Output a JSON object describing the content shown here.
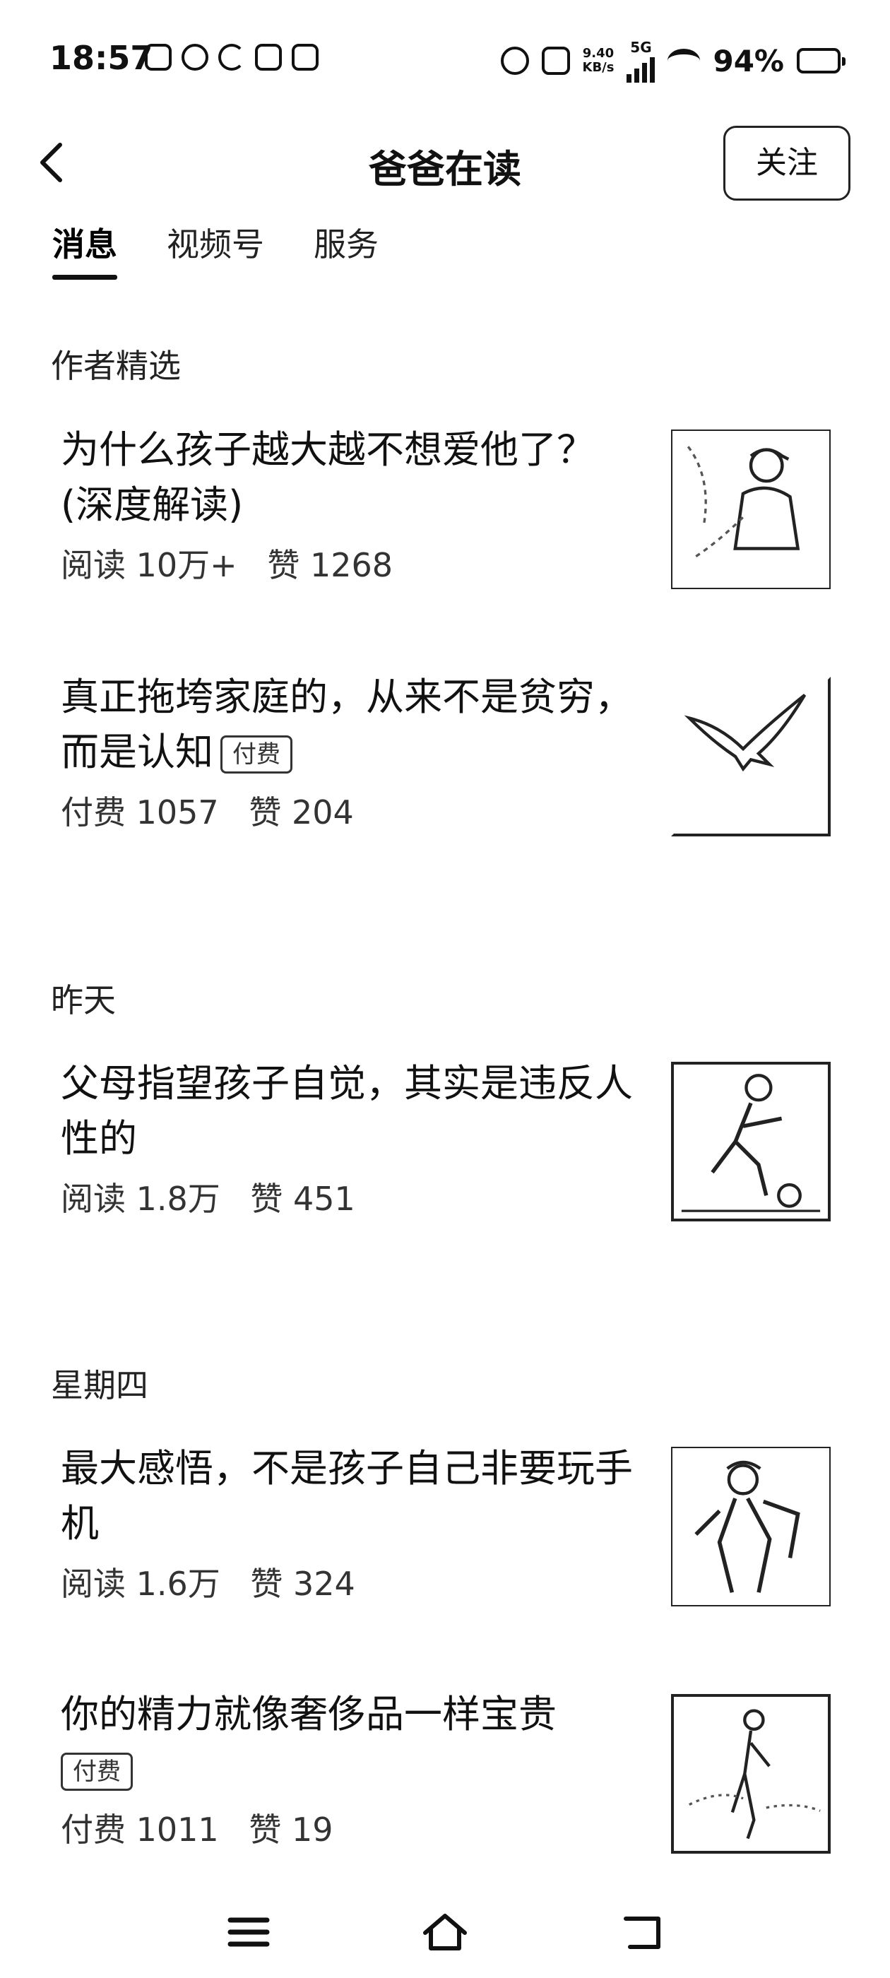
{
  "status_bar": {
    "time": "18:57",
    "speed_value": "9.40",
    "speed_unit": "KB/s",
    "network": "5G",
    "battery": "94%"
  },
  "header": {
    "title": "爸爸在读",
    "follow_label": "关注"
  },
  "tabs": [
    {
      "label": "消息",
      "active": true
    },
    {
      "label": "视频号",
      "active": false
    },
    {
      "label": "服务",
      "active": false
    }
  ],
  "sections": [
    {
      "label": "作者精选",
      "articles": [
        {
          "title": "为什么孩子越大越不想爱他了？(深度解读)",
          "stat1": "阅读 10万+",
          "stat2": "赞 1268",
          "paid": false,
          "thumb_icon": "man-with-cap-image"
        },
        {
          "title": "真正拖垮家庭的，从来不是贫穷，而是认知",
          "badge": "付费",
          "stat1": "付费 1057",
          "stat2": "赞 204",
          "paid": true,
          "thumb_icon": "eagle-image"
        }
      ]
    },
    {
      "label": "昨天",
      "articles": [
        {
          "title": "父母指望孩子自觉，其实是违反人性的",
          "stat1": "阅读 1.8万",
          "stat2": "赞 451",
          "paid": false,
          "thumb_icon": "soccer-player-image"
        }
      ]
    },
    {
      "label": "星期四",
      "articles": [
        {
          "title": "最大感悟，不是孩子自己非要玩手机",
          "stat1": "阅读 1.6万",
          "stat2": "赞 324",
          "paid": false,
          "thumb_icon": "hiker-image"
        },
        {
          "title": "你的精力就像奢侈品一样宝贵",
          "badge": "付费",
          "stat1": "付费 1011",
          "stat2": "赞 19",
          "paid": true,
          "thumb_icon": "runner-image"
        }
      ]
    }
  ],
  "bottom_nav": {
    "icons": [
      "menu-icon",
      "home-icon",
      "back-icon"
    ]
  }
}
